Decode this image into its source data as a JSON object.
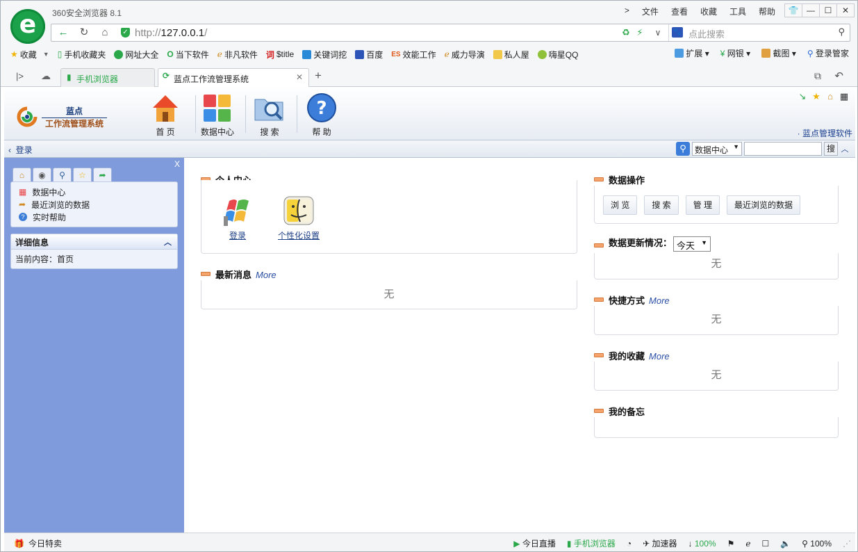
{
  "browser": {
    "app_title": "360安全浏览器 8.1",
    "menu": [
      "文件",
      "查看",
      "收藏",
      "工具",
      "帮助"
    ],
    "address": {
      "url_prefix": "http://",
      "url_host": "127.0.0.1",
      "url_suffix": "/"
    },
    "search_placeholder": "点此搜索",
    "bookmarks": [
      "收藏",
      "手机收藏夹",
      "网址大全",
      "当下软件",
      "非凡软件",
      "$title",
      "关键词挖",
      "百度",
      "效能工作",
      "威力导演",
      "私人屋",
      "嗨星QQ"
    ],
    "bookmarks_right": [
      "扩展",
      "网银",
      "截图",
      "登录管家"
    ],
    "tabs": [
      {
        "label": "手机浏览器"
      },
      {
        "label": "蓝点工作流管理系统"
      }
    ]
  },
  "app": {
    "brand_line1": "蓝点",
    "brand_line2": "工作流管理系统",
    "nav": [
      {
        "label": "首 页"
      },
      {
        "label": "数据中心"
      },
      {
        "label": "搜 索"
      },
      {
        "label": "帮 助"
      }
    ],
    "brand_link": "· 蓝点管理软件",
    "back_label": "登录",
    "quick_search": {
      "scope": "数据中心",
      "button": "搜"
    }
  },
  "sidebar": {
    "close": "X",
    "items": [
      "数据中心",
      "最近浏览的数据",
      "实时帮助"
    ],
    "detail_title": "详细信息",
    "detail_text": "当前内容：首页"
  },
  "main": {
    "personal": {
      "title": "个人中心",
      "links": [
        "登录",
        "个性化设置"
      ]
    },
    "news": {
      "title": "最新消息",
      "more": "More",
      "empty": "无"
    }
  },
  "right": {
    "data_ops": {
      "title": "数据操作",
      "buttons": [
        "浏 览",
        "搜 索",
        "管 理",
        "最近浏览的数据"
      ]
    },
    "updates": {
      "title": "数据更新情况：",
      "select": "今天",
      "empty": "无"
    },
    "shortcuts": {
      "title": "快捷方式",
      "more": "More",
      "empty": "无"
    },
    "favorites": {
      "title": "我的收藏",
      "more": "More",
      "empty": "无"
    },
    "memo": {
      "title": "我的备忘"
    }
  },
  "statusbar": {
    "left": "今日特卖",
    "live": "今日直播",
    "mobile": "手机浏览器",
    "accel": "加速器",
    "download": "100%",
    "zoom": "100%"
  },
  "colors": {
    "sidebar": "#7f9bdb",
    "accent_green": "#1aa14a",
    "link_blue": "#2a4fa6"
  }
}
